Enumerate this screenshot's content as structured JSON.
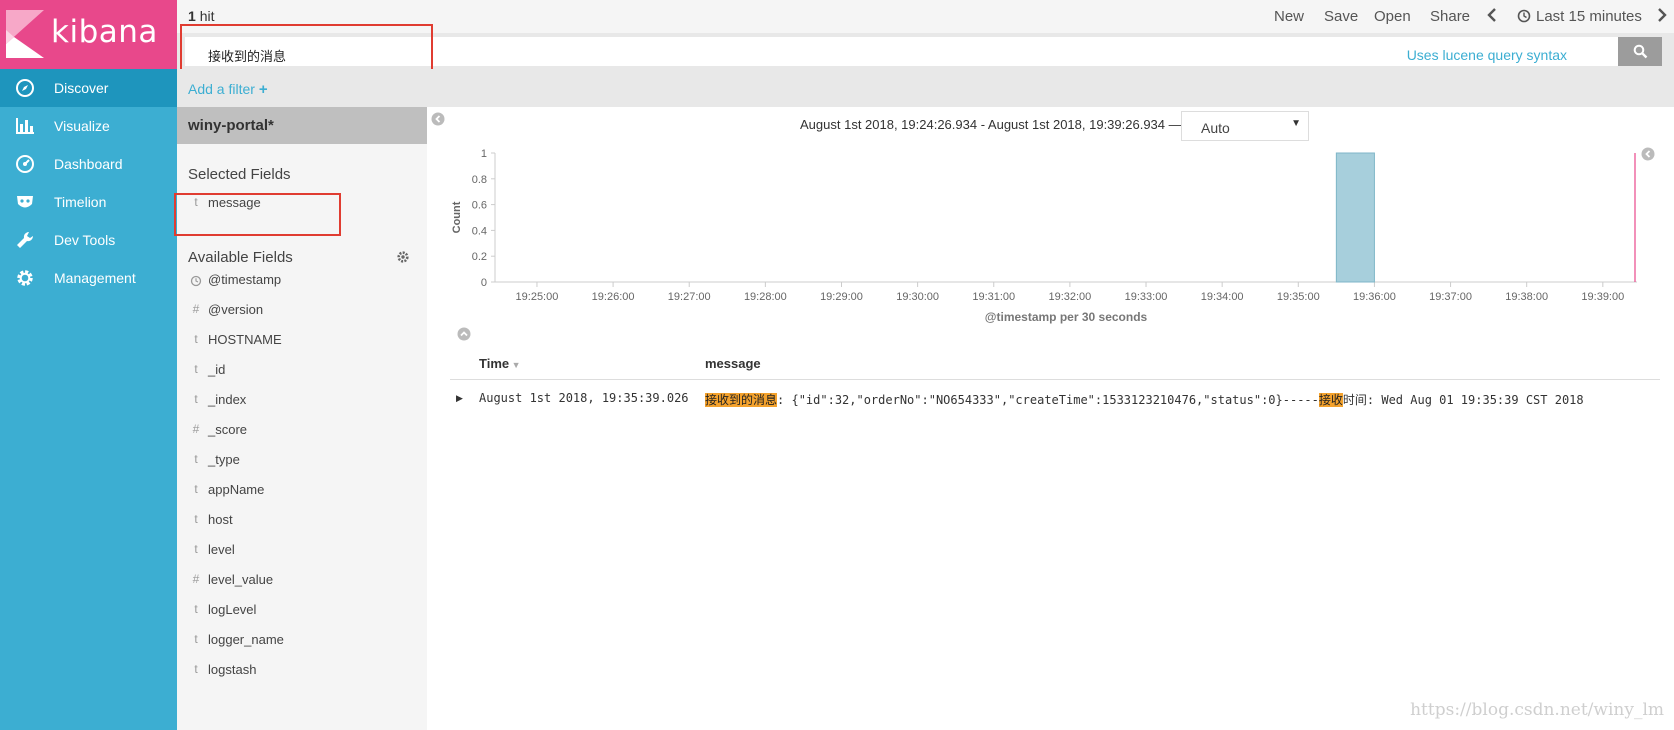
{
  "app": {
    "brand": "kibana",
    "accent_color": "#e8488b",
    "nav_color": "#3caed2"
  },
  "nav": {
    "items": [
      {
        "label": "Discover",
        "icon": "compass-icon",
        "active": true
      },
      {
        "label": "Visualize",
        "icon": "bar-chart-icon"
      },
      {
        "label": "Dashboard",
        "icon": "dashboard-icon"
      },
      {
        "label": "Timelion",
        "icon": "timelion-mask-icon"
      },
      {
        "label": "Dev Tools",
        "icon": "wrench-icon"
      },
      {
        "label": "Management",
        "icon": "gear-icon"
      }
    ]
  },
  "topbar": {
    "hit_count": "1",
    "hit_label": "hit",
    "new_label": "New",
    "save_label": "Save",
    "open_label": "Open",
    "share_label": "Share",
    "time_picker_label": "Last 15 minutes"
  },
  "search": {
    "query": "接收到的消息",
    "syntax_label": "Uses lucene query syntax",
    "add_filter_label": "Add a filter"
  },
  "fields_panel": {
    "index_pattern": "winy-portal*",
    "selected_title": "Selected Fields",
    "selected": [
      {
        "type": "t",
        "name": "message"
      }
    ],
    "available_title": "Available Fields",
    "available": [
      {
        "type": "clock",
        "name": "@timestamp"
      },
      {
        "type": "#",
        "name": "@version"
      },
      {
        "type": "t",
        "name": "HOSTNAME"
      },
      {
        "type": "t",
        "name": "_id"
      },
      {
        "type": "t",
        "name": "_index"
      },
      {
        "type": "#",
        "name": "_score"
      },
      {
        "type": "t",
        "name": "_type"
      },
      {
        "type": "t",
        "name": "appName"
      },
      {
        "type": "t",
        "name": "host"
      },
      {
        "type": "t",
        "name": "level"
      },
      {
        "type": "#",
        "name": "level_value"
      },
      {
        "type": "t",
        "name": "logLevel"
      },
      {
        "type": "t",
        "name": "logger_name"
      },
      {
        "type": "t",
        "name": "logstash"
      }
    ]
  },
  "histogram": {
    "range_label": "August 1st 2018, 19:24:26.934 - August 1st 2018, 19:39:26.934 —",
    "interval": "Auto"
  },
  "chart_data": {
    "type": "bar",
    "ylabel": "Count",
    "xlabel": "@timestamp per 30 seconds",
    "ylim": [
      0,
      1
    ],
    "yticks": [
      0,
      0.2,
      0.4,
      0.6,
      0.8,
      1
    ],
    "xticks": [
      "19:25:00",
      "19:26:00",
      "19:27:00",
      "19:28:00",
      "19:29:00",
      "19:30:00",
      "19:31:00",
      "19:32:00",
      "19:33:00",
      "19:34:00",
      "19:35:00",
      "19:36:00",
      "19:37:00",
      "19:38:00",
      "19:39:00"
    ],
    "bars": [
      {
        "start": "19:35:30",
        "end": "19:36:00",
        "value": 1
      }
    ],
    "bar_color": "#a7cfdc",
    "now_marker_color": "#e8488b"
  },
  "table": {
    "time_header": "Time",
    "message_header": "message",
    "rows": [
      {
        "time": "August 1st 2018, 19:35:39.026",
        "message_highlight_1": "接收到的消息",
        "message_part_1": ": {\"id\":32,\"orderNo\":\"NO654333\",\"createTime\":1533123210476,\"status\":0}-----",
        "message_highlight_2": "接收",
        "message_part_2": "时间: Wed Aug 01 19:35:39 CST 2018"
      }
    ]
  },
  "watermark": "https://blog.csdn.net/winy_lm"
}
